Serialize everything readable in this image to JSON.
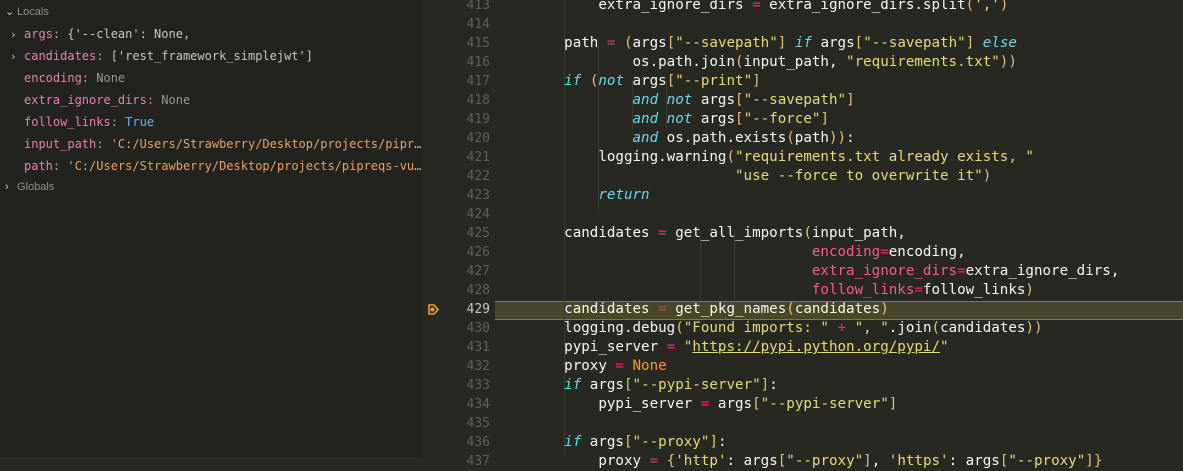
{
  "variables_panel": {
    "locals_label": "Locals",
    "globals_label": "Globals",
    "locals": [
      {
        "name": "args",
        "value": "{'--clean': None,",
        "expandable": true,
        "kind": "obj"
      },
      {
        "name": "candidates",
        "value": "['rest_framework_simplejwt']",
        "expandable": true,
        "kind": "obj"
      },
      {
        "name": "encoding",
        "value": "None",
        "expandable": false,
        "kind": "none"
      },
      {
        "name": "extra_ignore_dirs",
        "value": "None",
        "expandable": false,
        "kind": "none"
      },
      {
        "name": "follow_links",
        "value": "True",
        "expandable": false,
        "kind": "true"
      },
      {
        "name": "input_path",
        "value": "'C:/Users/Strawberry/Desktop/projects/pipr…",
        "expandable": false,
        "kind": "str"
      },
      {
        "name": "path",
        "value": "'C:/Users/Strawberry/Desktop/projects/pipreqs-vu…",
        "expandable": false,
        "kind": "str"
      }
    ]
  },
  "editor": {
    "current_line": 429,
    "lines": [
      {
        "n": "413",
        "code": "        extra_ignore_dirs = extra_ignore_dirs.split(',')"
      },
      {
        "n": "414",
        "code": ""
      },
      {
        "n": "415",
        "code": "    path = (args[\"--savepath\"] if args[\"--savepath\"] else"
      },
      {
        "n": "416",
        "code": "            os.path.join(input_path, \"requirements.txt\"))"
      },
      {
        "n": "417",
        "code": "    if (not args[\"--print\"]"
      },
      {
        "n": "418",
        "code": "            and not args[\"--savepath\"]"
      },
      {
        "n": "419",
        "code": "            and not args[\"--force\"]"
      },
      {
        "n": "420",
        "code": "            and os.path.exists(path)):"
      },
      {
        "n": "421",
        "code": "        logging.warning(\"requirements.txt already exists, \""
      },
      {
        "n": "422",
        "code": "                        \"use --force to overwrite it\")"
      },
      {
        "n": "423",
        "code": "        return"
      },
      {
        "n": "424",
        "code": ""
      },
      {
        "n": "425",
        "code": "    candidates = get_all_imports(input_path,"
      },
      {
        "n": "426",
        "code": "                                 encoding=encoding,"
      },
      {
        "n": "427",
        "code": "                                 extra_ignore_dirs=extra_ignore_dirs,"
      },
      {
        "n": "428",
        "code": "                                 follow_links=follow_links)"
      },
      {
        "n": "429",
        "code": "    candidates = get_pkg_names(candidates)"
      },
      {
        "n": "430",
        "code": "    logging.debug(\"Found imports: \" + \", \".join(candidates))"
      },
      {
        "n": "431",
        "code": "    pypi_server = \"https://pypi.python.org/pypi/\""
      },
      {
        "n": "432",
        "code": "    proxy = None"
      },
      {
        "n": "433",
        "code": "    if args[\"--pypi-server\"]:"
      },
      {
        "n": "434",
        "code": "        pypi_server = args[\"--pypi-server\"]"
      },
      {
        "n": "435",
        "code": ""
      },
      {
        "n": "436",
        "code": "    if args[\"--proxy\"]:"
      },
      {
        "n": "437",
        "code": "        proxy = {'http': args[\"--proxy\"], 'https': args[\"--proxy\"]}"
      }
    ]
  },
  "colors": {
    "editor_bg": "#272822",
    "panel_bg": "#22231e",
    "current_line_bg": "#47482a",
    "breakpoint": "#f0a030"
  }
}
